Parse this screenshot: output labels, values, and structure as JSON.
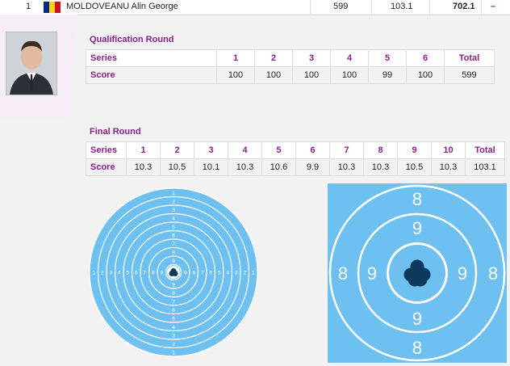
{
  "athlete": {
    "rank": "1",
    "name": "MOLDOVEANU Alin George",
    "qual_total": "599",
    "final_total": "103.1",
    "grand_total": "702.1",
    "flag_colors": [
      "#002b7f",
      "#fcd116",
      "#ce1126"
    ],
    "photo": "athlete-photo"
  },
  "qualification": {
    "title": "Qualification Round",
    "row_labels": [
      "Series",
      "Score"
    ],
    "series": [
      "1",
      "2",
      "3",
      "4",
      "5",
      "6",
      "Total"
    ],
    "scores": [
      "100",
      "100",
      "100",
      "100",
      "99",
      "100",
      "599"
    ]
  },
  "final": {
    "title": "Final Round",
    "row_labels": [
      "Series",
      "Score"
    ],
    "series": [
      "1",
      "2",
      "3",
      "4",
      "5",
      "6",
      "7",
      "8",
      "9",
      "10",
      "Total"
    ],
    "scores": [
      "10.3",
      "10.5",
      "10.1",
      "10.3",
      "10.6",
      "9.9",
      "10.3",
      "10.3",
      "10.5",
      "10.3",
      "103.1"
    ]
  },
  "targets": {
    "full_ring_labels": [
      "1",
      "2",
      "3",
      "4",
      "5",
      "6",
      "7",
      "8",
      "9"
    ],
    "zoom_ring_labels": [
      "8",
      "9"
    ],
    "colors": {
      "target": "#6ec0f0",
      "ring": "#ffffff",
      "shots": "#0d3a5c",
      "accent": "#8b1f8b"
    }
  }
}
